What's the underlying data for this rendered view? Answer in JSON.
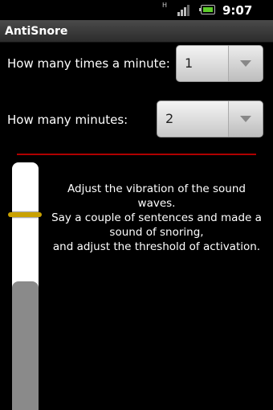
{
  "status": {
    "time": "9:07 am",
    "network": "H"
  },
  "app": {
    "title": "AntiSnore"
  },
  "form": {
    "times_label": "How many times a minute:",
    "times_value": "1",
    "minutes_label": "How many minutes:",
    "minutes_value": "2"
  },
  "meter": {
    "level_fraction": 0.52,
    "threshold_fraction": 0.8
  },
  "instructions": {
    "line1": "Adjust the vibration of the sound waves.",
    "line2": "Say a couple of sentences and made a sound of snoring,",
    "line3": "and adjust the threshold of activation."
  },
  "colors": {
    "accent_line": "#b00000",
    "threshold": "#c9a100",
    "battery": "#5dcc2a"
  }
}
